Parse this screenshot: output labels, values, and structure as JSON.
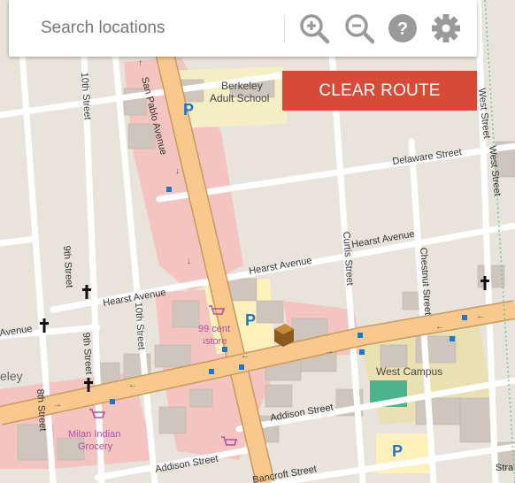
{
  "search": {
    "placeholder": "Search locations"
  },
  "toolbar": {
    "zoom_in_icon": "zoom-in-icon",
    "zoom_out_icon": "zoom-out-icon",
    "help_icon": "question-icon",
    "settings_icon": "gear-icon"
  },
  "route": {
    "clear_label": "CLEAR ROUTE"
  },
  "map": {
    "streets": {
      "san_pablo": "San Pablo Avenue",
      "tenth_a": "10th Street",
      "tenth_b": "10th Street",
      "ninth_a": "9th Street",
      "ninth_b": "9th Street",
      "eighth": "8th Street",
      "hearst_a": "Hearst Avenue",
      "hearst_b": "Hearst Avenue",
      "hearst_c": "Hearst Avenue",
      "hearst_d": "Avenue",
      "delaware": "Delaware Street",
      "curtis": "Curtis Street",
      "chestnut": "Chestnut Street",
      "west_a": "West Street",
      "west_b": "West Street",
      "addison_a": "Addison Street",
      "addison_b": "Addison Street",
      "bancroft": "Bancroft Street",
      "strawberry": "Stra",
      "berkeley": "eley"
    },
    "places": {
      "school_line1": "Berkeley",
      "school_line2": "Adult School",
      "store_line1": "99 cent",
      "store_line2": "store",
      "grocery_line1": "Milan Indian",
      "grocery_line2": "Grocery",
      "campus": "West Campus"
    },
    "colors": {
      "road_primary": "#f8c88c",
      "road_primary_edge": "#c89a5c",
      "residential": "#f4c5c0",
      "parking": "#fff1bb",
      "building": "#cec5bd",
      "campus": "#ebe0a0",
      "green": "#4cb38e",
      "shop_label": "#b04fa6",
      "transit": "#1f75c8",
      "clear_button": "#d84a38"
    }
  }
}
